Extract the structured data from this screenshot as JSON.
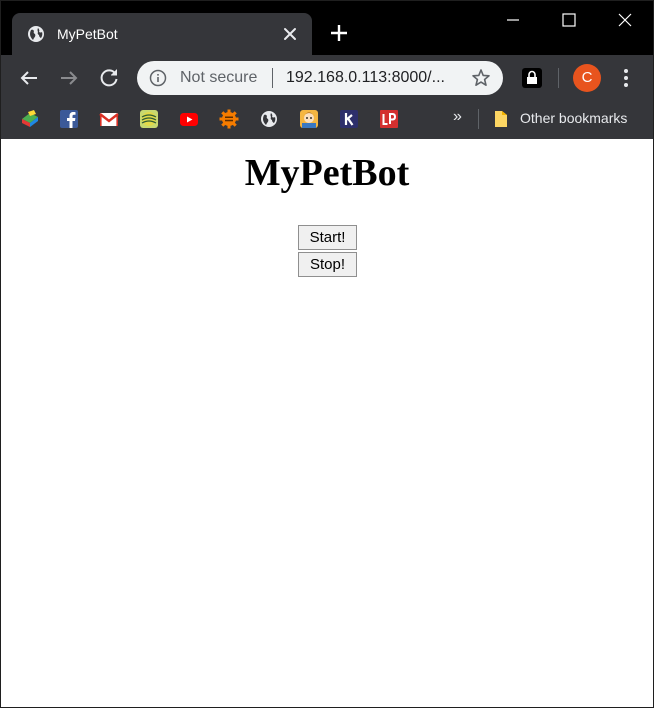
{
  "browser": {
    "tab": {
      "title": "MyPetBot",
      "favicon": "globe-icon"
    },
    "omnibox": {
      "security_label": "Not secure",
      "url": "192.168.0.113:8000/..."
    },
    "profile_initial": "C",
    "colors": {
      "titlebar": "#000000",
      "toolbar": "#35363a",
      "omnibox_bg": "#f1f3f4",
      "avatar": "#e8541e"
    },
    "bookmarks": {
      "items": [
        {
          "icon": "colorful-app-icon"
        },
        {
          "icon": "facebook-icon"
        },
        {
          "icon": "gmail-icon"
        },
        {
          "icon": "striped-globe-icon"
        },
        {
          "icon": "youtube-icon"
        },
        {
          "icon": "orange-gear-icon"
        },
        {
          "icon": "globe-icon"
        },
        {
          "icon": "avatar-face-icon"
        },
        {
          "icon": "k-letter-icon"
        },
        {
          "icon": "lp-icon"
        }
      ],
      "overflow_label": "»",
      "other_label": "Other bookmarks"
    }
  },
  "page": {
    "title": "MyPetBot",
    "start_label": "Start!",
    "stop_label": "Stop!"
  }
}
